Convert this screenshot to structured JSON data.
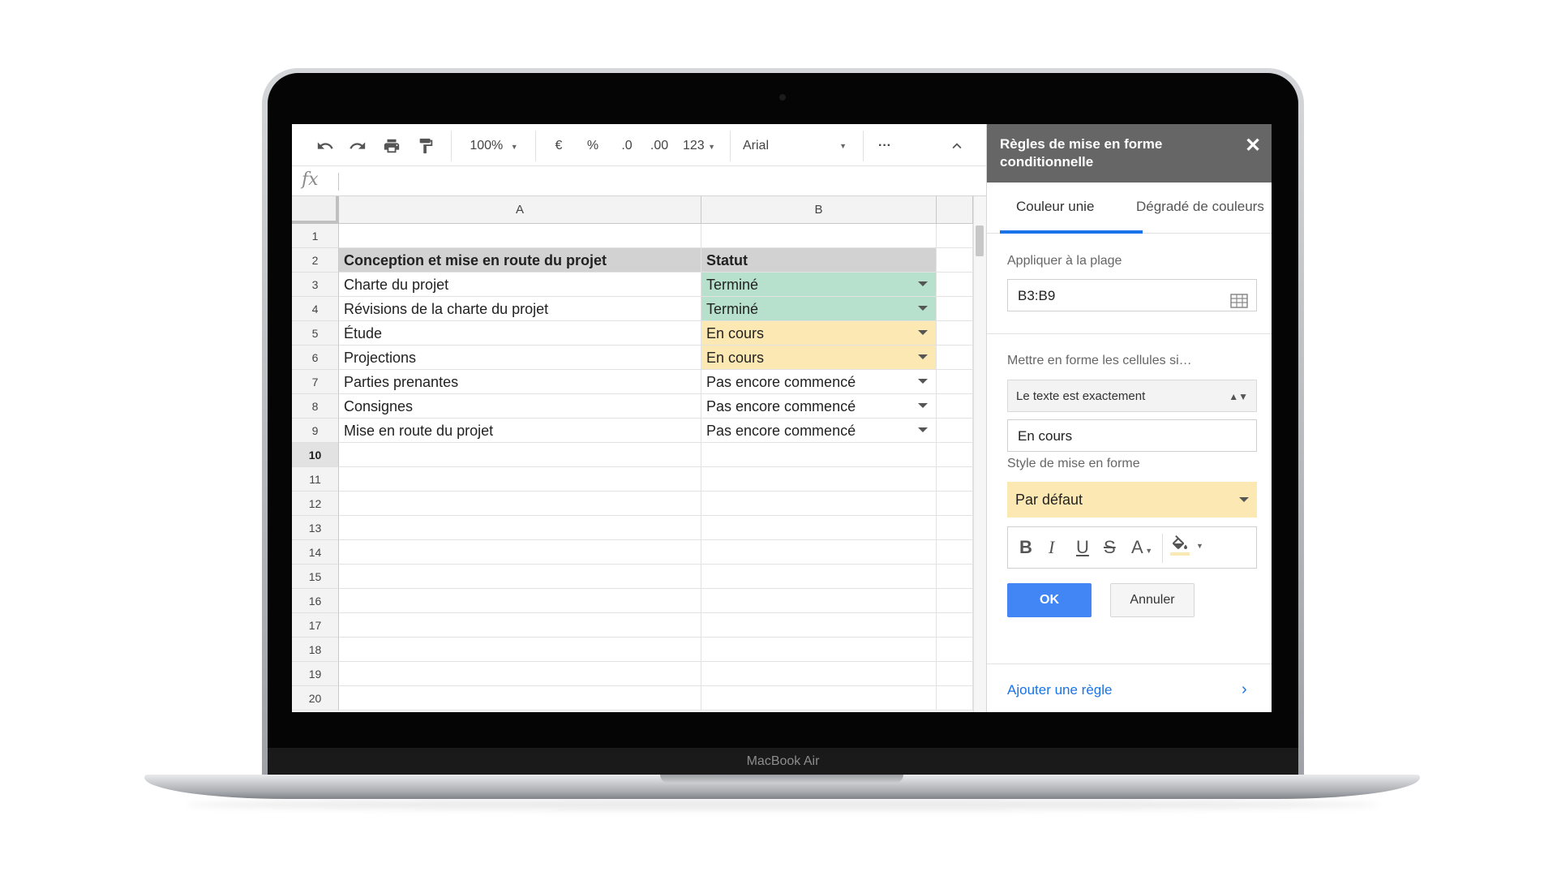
{
  "device": {
    "label": "MacBook Air"
  },
  "toolbar": {
    "zoom": "100%",
    "currency": "€",
    "percent": "%",
    "decrease_decimals": ".0",
    "increase_decimals": ".00",
    "number_format": "123",
    "font": "Arial",
    "more": "···"
  },
  "formula_bar": {
    "fx": "fx",
    "value": ""
  },
  "grid": {
    "columns": [
      "A",
      "B"
    ],
    "rows": [
      {
        "num": "1",
        "a": "",
        "b": ""
      },
      {
        "num": "2",
        "a": "Conception et mise en route du projet",
        "b": "Statut"
      },
      {
        "num": "3",
        "a": "Charte du projet",
        "b": "Terminé"
      },
      {
        "num": "4",
        "a": "Révisions de la charte du projet",
        "b": "Terminé"
      },
      {
        "num": "5",
        "a": "Étude",
        "b": "En cours"
      },
      {
        "num": "6",
        "a": "Projections",
        "b": "En cours"
      },
      {
        "num": "7",
        "a": "Parties prenantes",
        "b": "Pas encore commencé"
      },
      {
        "num": "8",
        "a": "Consignes",
        "b": "Pas encore commencé"
      },
      {
        "num": "9",
        "a": "Mise en route du projet",
        "b": "Pas encore commencé"
      },
      {
        "num": "10",
        "a": "",
        "b": ""
      },
      {
        "num": "11",
        "a": "",
        "b": ""
      },
      {
        "num": "12",
        "a": "",
        "b": ""
      },
      {
        "num": "13",
        "a": "",
        "b": ""
      },
      {
        "num": "14",
        "a": "",
        "b": ""
      },
      {
        "num": "15",
        "a": "",
        "b": ""
      },
      {
        "num": "16",
        "a": "",
        "b": ""
      },
      {
        "num": "17",
        "a": "",
        "b": ""
      },
      {
        "num": "18",
        "a": "",
        "b": ""
      },
      {
        "num": "19",
        "a": "",
        "b": ""
      },
      {
        "num": "20",
        "a": "",
        "b": ""
      }
    ],
    "colors": {
      "done": "#b7e1cd",
      "in_progress": "#fce8b2",
      "header": "#d2d2d2"
    }
  },
  "panel": {
    "title": "Règles de mise en forme conditionnelle",
    "close": "✕",
    "tabs": [
      "Couleur unie",
      "Dégradé de couleurs"
    ],
    "range_label": "Appliquer à la plage",
    "range_value": "B3:B9",
    "condition_label": "Mettre en forme les cellules si…",
    "condition_value": "Le texte est exactement",
    "condition_text": "En cours",
    "style_label": "Style de mise en forme",
    "style_value": "Par défaut",
    "style_color": "#fce8b2",
    "format_buttons": [
      "B",
      "I",
      "U",
      "S",
      "A"
    ],
    "ok": "OK",
    "cancel": "Annuler",
    "add_rule": "Ajouter une règle",
    "add_rule_chevron": "›"
  }
}
